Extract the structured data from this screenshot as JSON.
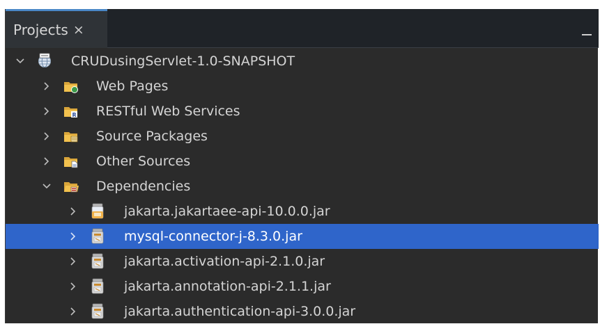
{
  "panel": {
    "tab": {
      "title": "Projects",
      "close_glyph": "×"
    },
    "minimize_icon": "minimize-icon"
  },
  "tree": {
    "root": {
      "label": "CRUDusingServlet-1.0-SNAPSHOT",
      "icon": "web-project-globe-icon",
      "expanded": true
    },
    "nodes": [
      {
        "label": "Web Pages",
        "icon": "folder-web-icon",
        "expanded": false
      },
      {
        "label": "RESTful Web Services",
        "icon": "folder-rest-icon",
        "expanded": false
      },
      {
        "label": "Source Packages",
        "icon": "folder-package-icon",
        "expanded": false
      },
      {
        "label": "Other Sources",
        "icon": "folder-other-icon",
        "expanded": false
      },
      {
        "label": "Dependencies",
        "icon": "folder-dependencies-icon",
        "expanded": true
      }
    ],
    "dependencies": [
      {
        "label": "jakarta.jakartaee-api-10.0.0.jar",
        "icon": "jar-icon",
        "selected": false
      },
      {
        "label": "mysql-connector-j-8.3.0.jar",
        "icon": "jar-icon",
        "selected": true
      },
      {
        "label": "jakarta.activation-api-2.1.0.jar",
        "icon": "jar-icon",
        "selected": false
      },
      {
        "label": "jakarta.annotation-api-2.1.1.jar",
        "icon": "jar-icon",
        "selected": false
      },
      {
        "label": "jakarta.authentication-api-3.0.0.jar",
        "icon": "jar-icon",
        "selected": false
      }
    ]
  },
  "colors": {
    "background": "#2b2b2b",
    "tab_accent": "#4a88c7",
    "selection": "#2f65ca",
    "text": "#d4d4d4"
  }
}
